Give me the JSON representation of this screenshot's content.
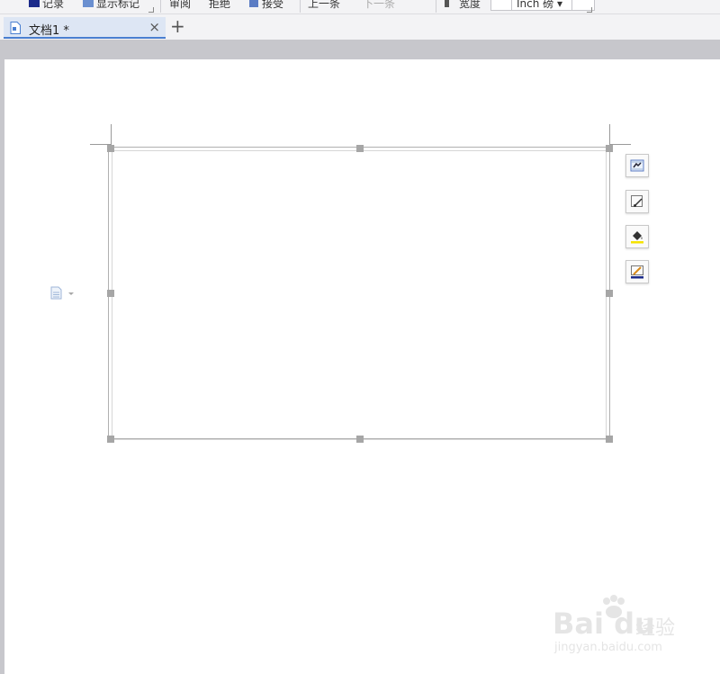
{
  "ribbon": {
    "items": [
      "记录",
      "显示标记",
      "审阅",
      "拒绝",
      "接受",
      "上一条",
      "下一条"
    ],
    "field_label": "宽度",
    "field_value": "Inch 磅 ▾"
  },
  "tabs": [
    {
      "label": "文档1 *",
      "close": "×"
    }
  ],
  "new_tab": "+",
  "colors": {
    "tab_active_bg": "#dde6f4",
    "tab_underline": "#4a7fd0",
    "canvas_bg": "#c7c7cc",
    "handle": "#a6a6a6"
  },
  "float_tools": [
    {
      "name": "layout-options-icon"
    },
    {
      "name": "edit-shape-icon"
    },
    {
      "name": "fill-color-icon"
    },
    {
      "name": "outline-color-icon"
    }
  ],
  "watermark": {
    "brand": "Bai du",
    "cn": "经验",
    "url": "jingyan.baidu.com"
  }
}
